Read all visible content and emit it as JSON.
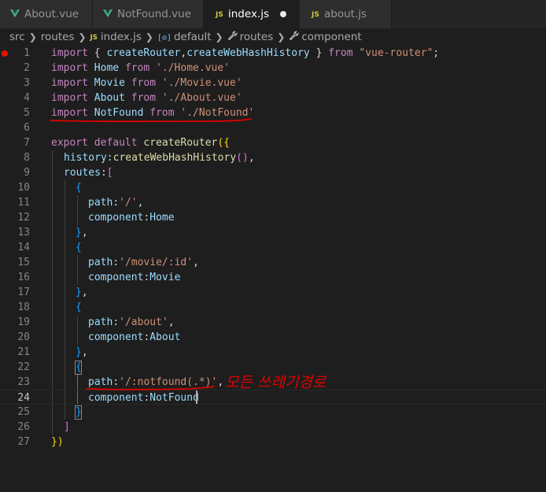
{
  "tabs": [
    {
      "label": "About.vue",
      "icon": "vue-icon",
      "active": false
    },
    {
      "label": "NotFound.vue",
      "icon": "vue-icon",
      "active": false
    },
    {
      "label": "index.js",
      "icon": "js-icon",
      "active": true,
      "unsaved": true
    },
    {
      "label": "about.js",
      "icon": "js-icon",
      "active": false
    }
  ],
  "js_badge": "JS",
  "breadcrumb": {
    "items": [
      "src",
      "routes",
      "index.js",
      "default",
      "routes",
      "component"
    ],
    "module_badge": "[⊘]"
  },
  "colors": {
    "accent_red": "#e51400",
    "annotation_red": "#e00000",
    "keyword": "#c586c0",
    "string": "#ce9178",
    "function": "#dcdcaa",
    "variable": "#9cdcfe"
  },
  "annotation_text": "모든 쓰레기경로",
  "line_numbers": [
    "1",
    "2",
    "3",
    "4",
    "5",
    "6",
    "7",
    "8",
    "9",
    "10",
    "11",
    "12",
    "13",
    "14",
    "15",
    "16",
    "17",
    "18",
    "19",
    "20",
    "21",
    "22",
    "23",
    "24",
    "25",
    "26",
    "27"
  ],
  "code": {
    "l1": {
      "kw1": "import",
      "p1": " { ",
      "f1": "createRouter",
      "p2": ",",
      "f2": "createWebHashHistory",
      "p3": " } ",
      "kw2": "from",
      "p4": " ",
      "s1": "\"vue-router\"",
      "p5": ";"
    },
    "l2": {
      "kw1": "import",
      "v1": " Home ",
      "kw2": "from",
      "p1": " ",
      "s1": "'./Home.vue'"
    },
    "l3": {
      "kw1": "import",
      "v1": " Movie ",
      "kw2": "from",
      "p1": " ",
      "s1": "'./Movie.vue'"
    },
    "l4": {
      "kw1": "import",
      "v1": " About ",
      "kw2": "from",
      "p1": " ",
      "s1": "'./About.vue'"
    },
    "l5": {
      "kw1": "import",
      "v1": " NotFound ",
      "kw2": "from",
      "p1": " ",
      "s1": "'./NotFound'"
    },
    "l7": {
      "kw1": "export",
      "p1": " ",
      "kw2": "default",
      "p2": " ",
      "f1": "createRouter",
      "b1": "({"
    },
    "l8": {
      "v1": "history",
      "p1": ":",
      "f1": "createWebHashHistory",
      "b1": "()",
      "p2": ","
    },
    "l9": {
      "v1": "routes",
      "p1": ":",
      "b1": "["
    },
    "l10": {
      "b1": "{"
    },
    "l11": {
      "v1": "path",
      "p1": ":",
      "s1": "'/'",
      "p2": ","
    },
    "l12": {
      "v1": "component",
      "p1": ":",
      "v2": "Home"
    },
    "l13": {
      "b1": "}",
      "p1": ","
    },
    "l14": {
      "b1": "{"
    },
    "l15": {
      "v1": "path",
      "p1": ":",
      "s1": "'/movie/:id'",
      "p2": ","
    },
    "l16": {
      "v1": "component",
      "p1": ":",
      "v2": "Movie"
    },
    "l17": {
      "b1": "}",
      "p1": ","
    },
    "l18": {
      "b1": "{"
    },
    "l19": {
      "v1": "path",
      "p1": ":",
      "s1": "'/about'",
      "p2": ","
    },
    "l20": {
      "v1": "component",
      "p1": ":",
      "v2": "About"
    },
    "l21": {
      "b1": "}",
      "p1": ","
    },
    "l22": {
      "b1": "{"
    },
    "l23": {
      "v1": "path",
      "p1": ":",
      "s1": "'/:notfound(.*)'",
      "p2": ","
    },
    "l24": {
      "v1": "component",
      "p1": ":",
      "v2": "NotFound"
    },
    "l25": {
      "b1": "}"
    },
    "l26": {
      "b1": "]"
    },
    "l27": {
      "b1": "})"
    }
  }
}
